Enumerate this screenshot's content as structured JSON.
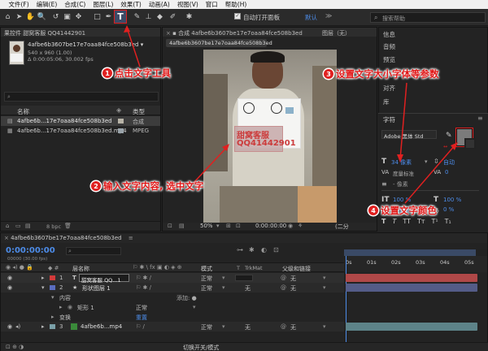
{
  "menu": [
    "文件(F)",
    "编辑(E)",
    "合成(C)",
    "图层(L)",
    "效果(T)",
    "动画(A)",
    "视图(V)",
    "窗口",
    "帮助(H)"
  ],
  "toolbar": {
    "auto_open_panel": "自动打开面板",
    "workspace_default": "默认",
    "search_placeholder": "搜索帮助"
  },
  "project": {
    "tab_label": "果控件 甜窝客服 QQ41442901",
    "file_name": "4afbe6b3607be17e7oaa84fce508b3ed ▾",
    "file_dims": "540 x 960 (1.00)",
    "file_duration": "Δ 0:00:05:06, 30.002 fps",
    "search_placeholder": "",
    "col_name": "名称",
    "col_type": "类型",
    "items": [
      {
        "name": "4afbe6b...17e7oaa84fce508b3ed",
        "type": "合成"
      },
      {
        "name": "4afbe6b...17e7oaa84fce508b3ed.mp4",
        "type": "MPEG"
      }
    ],
    "bpc": "8 bpc"
  },
  "comp": {
    "tab_title": "合成 4afbe6b3607be17e7oaa84fce508b3ed",
    "layer_tab": "图层（无）",
    "breadcrumb": "4afbe6b3607be17e7oaa84fce508b3ed",
    "overlay_line1": "甜窝客服",
    "overlay_line2": "QQ41442901",
    "zoom": "50%",
    "timecode": "0:00:00:00",
    "quality": "(二分"
  },
  "right_panel": {
    "items": [
      "信息",
      "音频",
      "预览",
      "效果和预设",
      "对齐",
      "库"
    ],
    "char_title": "字符",
    "font": "Adobe 黑体 Std",
    "font_size": "34 像素",
    "leading": "自动",
    "kerning": "度量标准",
    "tracking": "0",
    "stroke": "- 像素",
    "vscale": "100 %",
    "hscale": "100 %",
    "baseline": "0 像素",
    "tsume": "0 %",
    "text_styles": [
      "T",
      "T",
      "TT",
      "Tт",
      "T¹",
      "T₁"
    ]
  },
  "annotations": {
    "a1": "点击文字工具",
    "a2": "输入文字内容, 选中文字",
    "a3": "设置文字大小字体等参数",
    "a4": "设置文字颜色",
    "n1": "1",
    "n2": "2",
    "n3": "3",
    "n4": "4"
  },
  "timeline": {
    "tab_label": "4afbe6b3607be17e7oaa84fce508b3ed",
    "timecode": "0:00:00:00",
    "frames": "00000 (30.00 fps)",
    "col_layer_name": "层名称",
    "col_mode": "模式",
    "col_trkmat": "TrkMat",
    "col_parent": "父级和链接",
    "ruler": [
      "0s",
      "01s",
      "02s",
      "03s",
      "04s",
      "05s"
    ],
    "layers": [
      {
        "num": "1",
        "icon": "T",
        "name": "甜窝客服 QQ...1",
        "mode": "正常",
        "parent": "无",
        "color": "#d33a3a"
      },
      {
        "num": "2",
        "icon": "★",
        "name": "形状图层 1",
        "mode": "正常",
        "trkmat": "无",
        "parent": "无",
        "color": "#5a6dbf"
      }
    ],
    "contents_label": "内容",
    "add_label": "添加: ●",
    "rect_label": "矩形 1",
    "rect_mode": "正常",
    "transform_label": "变换",
    "reset_label": "重置",
    "layer3": {
      "num": "3",
      "name": "4afbe6b...mp4",
      "mode": "正常",
      "trkmat": "无",
      "parent": "无"
    },
    "footer": "切换开关/模式"
  }
}
